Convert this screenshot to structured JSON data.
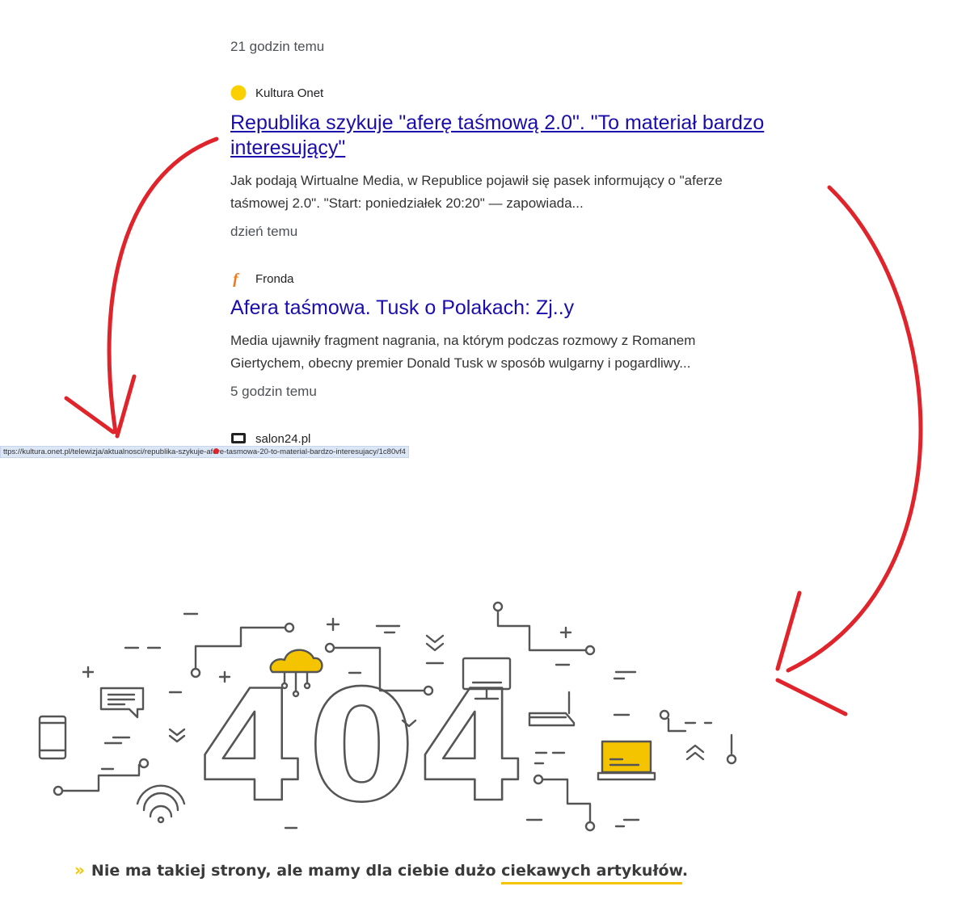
{
  "results": {
    "r0": {
      "time": "21 godzin temu"
    },
    "r1": {
      "source": "Kultura Onet",
      "title_line1": "Republika szykuje \"aferę taśmową 2.0\". \"To materiał bardzo",
      "title_line2": "interesujący\"",
      "snippet_line1": "Jak podają Wirtualne Media, w Republice pojawił się pasek informujący o \"aferze",
      "snippet_line2": "taśmowej 2.0\". \"Start: poniedziałek 20:20\" — zapowiada...",
      "time": "dzień temu"
    },
    "r2": {
      "source": "Fronda",
      "title": "Afera taśmowa. Tusk o Polakach: Zj..y",
      "snippet_line1": "Media ujawniły fragment nagrania, na którym podczas rozmowy z Romanem",
      "snippet_line2": "Giertychem, obecny premier Donald Tusk w sposób wulgarny i pogardliwy...",
      "time": "5 godzin temu"
    },
    "r3": {
      "source": "salon24.pl"
    }
  },
  "status_url": "ttps://kultura.onet.pl/telewizja/aktualnosci/republika-szykuje-afere-tasmowa-20-to-material-bardzo-interesujacy/1c80vf4",
  "error_page": {
    "code": "404",
    "message_prefix": "Nie ma takiej strony, ale mamy dla ciebie dużo",
    "message_link": "ciekawych artykułów",
    "message_suffix": ".",
    "chevron": "»"
  },
  "icons": {
    "kultura": "yellow-circle-icon",
    "fronda": "fronda-f-icon",
    "salon24": "salon24-monitor-icon"
  },
  "colors": {
    "link": "#1a0dab",
    "accent": "#f5c400",
    "annotation": "#e0242b",
    "illustration": "#555555"
  }
}
